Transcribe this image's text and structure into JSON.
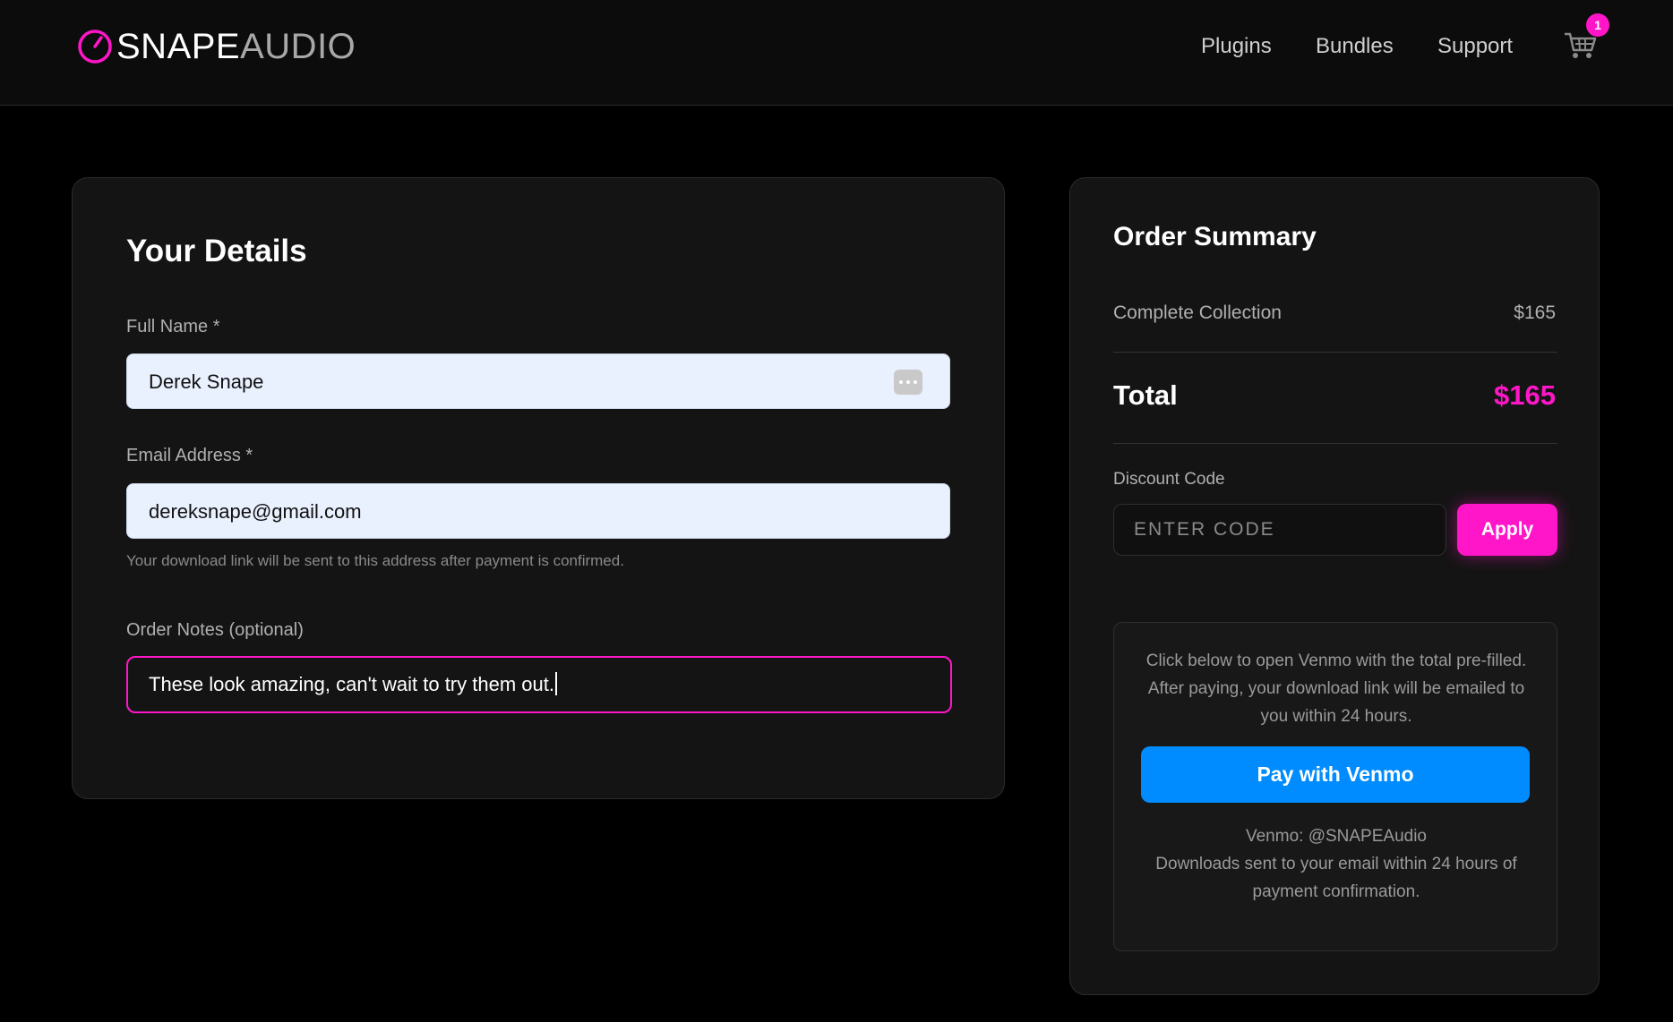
{
  "brand": {
    "part1": "SNAPE",
    "part2": "AUDIO",
    "accent_color": "#ff16c8"
  },
  "nav": {
    "items": [
      "Plugins",
      "Bundles",
      "Support"
    ],
    "cart_icon": "cart-icon",
    "cart_count": "1"
  },
  "details": {
    "title": "Your Details",
    "full_name_label": "Full Name *",
    "full_name_value": "Derek Snape",
    "password_manager_icon": "password-manager-icon",
    "email_label": "Email Address *",
    "email_value": "dereksnape@gmail.com",
    "email_hint": "Your download link will be sent to this address after payment is confirmed.",
    "notes_label": "Order Notes (optional)",
    "notes_value": "These look amazing, can't wait to try them out."
  },
  "summary": {
    "title": "Order Summary",
    "item_name": "Complete Collection",
    "item_price": "$165",
    "total_label": "Total",
    "total_value": "$165",
    "discount_label": "Discount Code",
    "discount_placeholder": "ENTER CODE",
    "apply_label": "Apply",
    "venmo_intro": "Click below to open Venmo with the total pre-filled. After paying, your download link will be emailed to you within 24 hours.",
    "venmo_button": "Pay with Venmo",
    "venmo_button_color": "#008cff",
    "venmo_handle": "Venmo: @SNAPEAudio",
    "venmo_footer": "Downloads sent to your email within 24 hours of payment confirmation."
  }
}
